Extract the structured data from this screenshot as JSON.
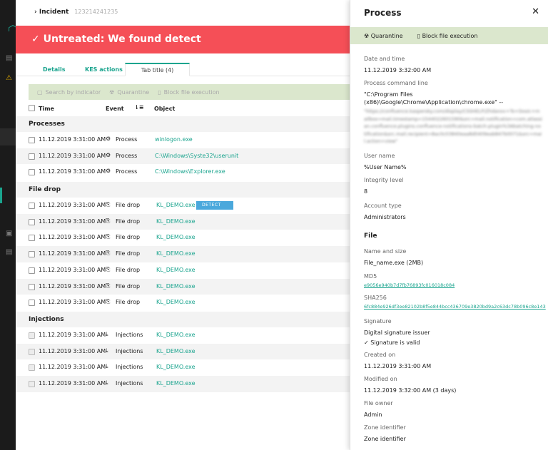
{
  "incident": {
    "label": "Incident",
    "id": "123214241235"
  },
  "banner": {
    "text": "Untreated: We found detect"
  },
  "tabs": [
    {
      "label": "Details"
    },
    {
      "label": "KES actions"
    },
    {
      "label": "Tab title (4)"
    }
  ],
  "toolbar": {
    "search": "Search by indicator",
    "quarantine": "Quarantine",
    "block": "Block file execution"
  },
  "columns": {
    "time": "Time",
    "event": "Event",
    "object": "Object"
  },
  "sections": [
    {
      "title": "Processes",
      "rows": [
        {
          "time": "11.12.2019 3:31:00 AM",
          "event": "Process",
          "object": "winlogon.exe"
        },
        {
          "time": "11.12.2019 3:31:00 AM",
          "event": "Process",
          "object": "C:\\Windows\\Syste32\\userunit"
        },
        {
          "time": "11.12.2019 3:31:00 AM",
          "event": "Process",
          "object": "C:\\Windows\\Explorer.exe"
        }
      ]
    },
    {
      "title": "File drop",
      "rows": [
        {
          "time": "11.12.2019 3:31:00 AM",
          "event": "File drop",
          "object": "KL_DEMO.exe",
          "badge": "DETECT"
        },
        {
          "time": "11.12.2019 3:31:00 AM",
          "event": "File drop",
          "object": "KL_DEMO.exe"
        },
        {
          "time": "11.12.2019 3:31:00 AM",
          "event": "File drop",
          "object": "KL_DEMO.exe"
        },
        {
          "time": "11.12.2019 3:31:00 AM",
          "event": "File drop",
          "object": "KL_DEMO.exe"
        },
        {
          "time": "11.12.2019 3:31:00 AM",
          "event": "File drop",
          "object": "KL_DEMO.exe"
        },
        {
          "time": "11.12.2019 3:31:00 AM",
          "event": "File drop",
          "object": "KL_DEMO.exe"
        },
        {
          "time": "11.12.2019 3:31:00 AM",
          "event": "File drop",
          "object": "KL_DEMO.exe"
        }
      ]
    },
    {
      "title": "Injections",
      "rows": [
        {
          "time": "11.12.2019 3:31:00 AM",
          "event": "Injections",
          "object": "KL_DEMO.exe"
        },
        {
          "time": "11.12.2019 3:31:00 AM",
          "event": "Injections",
          "object": "KL_DEMO.exe"
        },
        {
          "time": "11.12.2019 3:31:00 AM",
          "event": "Injections",
          "object": "KL_DEMO.exe"
        },
        {
          "time": "11.12.2019 3:31:00 AM",
          "event": "Injections",
          "object": "KL_DEMO.exe"
        }
      ]
    }
  ],
  "panel": {
    "title": "Process",
    "quarantine": "Quarantine",
    "block": "Block file execution",
    "date_label": "Date and time",
    "date": "11.12.2019 3:32:00 AM",
    "cmd_label": "Process command line",
    "cmd": "\"C:\\Program Files (x86)\\Google\\Chrome\\Application\\chrome.exe\" --",
    "cmd_blurred": "\"https://confluence.kaspersky.com/display/CSSHELP/Zhdanov+To+Dosic+mailbox=mail.timestamp=1544022601590&src=mail.notification=com.atlassian.confluence.plugins.confluence-notifications-batch-plugin%3Abatching-notification&src.mail.recipient=8ac0c03840eaa8d0409eab847b0071&src=mail.action=view\"",
    "user_label": "User name",
    "user": "%User Name%",
    "integrity_label": "Integrity level",
    "integrity": "8",
    "account_label": "Account type",
    "account": "Administrators",
    "file_heading": "File",
    "name_label": "Name and size",
    "name": "File_name.exe (2MB)",
    "md5_label": "MD5",
    "md5": "e9056e940b7d7fb76893fc016018c084",
    "sha_label": "SHA256",
    "sha": "6fc884e926df3ee82102b8f5e844bcc436709e3820bd9a2c63dc78b096c8e143",
    "sig_label": "Signature",
    "sig_issuer": "Digital signature issuer",
    "sig_valid": "Signature is valid",
    "created_label": "Created on",
    "created": "11.12.2019 3:31:00 AM",
    "modified_label": "Modified on",
    "modified": "11.12.2019 3:32:00 AM (3 days)",
    "owner_label": "File owner",
    "owner": "Admin",
    "zone_label": "Zone identifier",
    "zone": "Zone identifier"
  },
  "colors": {
    "accent": "#1aa48e",
    "banner": "#f54f57",
    "toolbar": "#dbe7cd",
    "badge": "#4aa8dc"
  }
}
